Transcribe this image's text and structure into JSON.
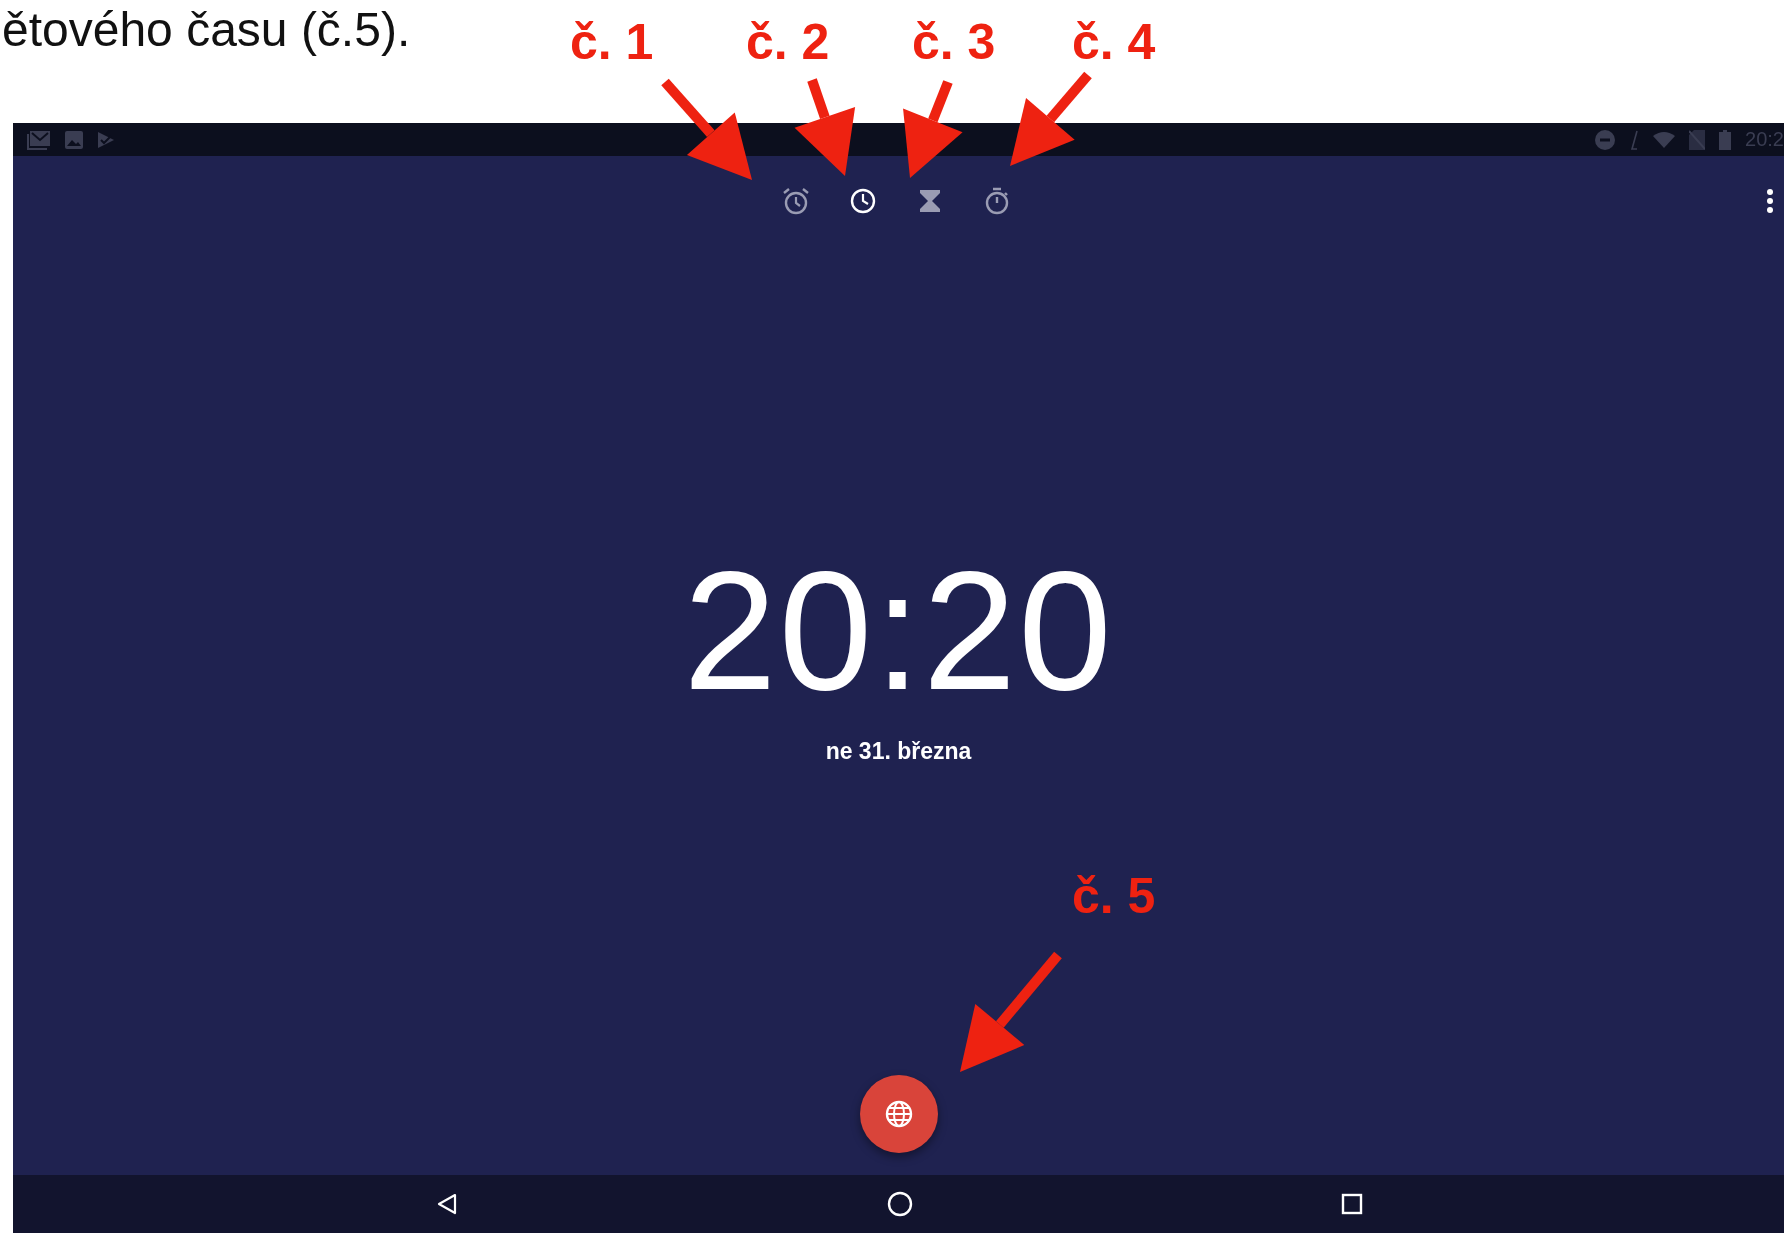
{
  "caption": "ětového času (č.5).",
  "annotations": [
    {
      "label": "č. 1"
    },
    {
      "label": "č. 2"
    },
    {
      "label": "č. 3"
    },
    {
      "label": "č. 4"
    },
    {
      "label": "č. 5"
    }
  ],
  "status_bar": {
    "time": "20:2"
  },
  "tabs": [
    {
      "kind": "alarm",
      "selected": false
    },
    {
      "kind": "clock",
      "selected": true
    },
    {
      "kind": "timer",
      "selected": false
    },
    {
      "kind": "stopwatch",
      "selected": false
    }
  ],
  "clock": {
    "time": "20:20",
    "date": "ne 31. března"
  }
}
